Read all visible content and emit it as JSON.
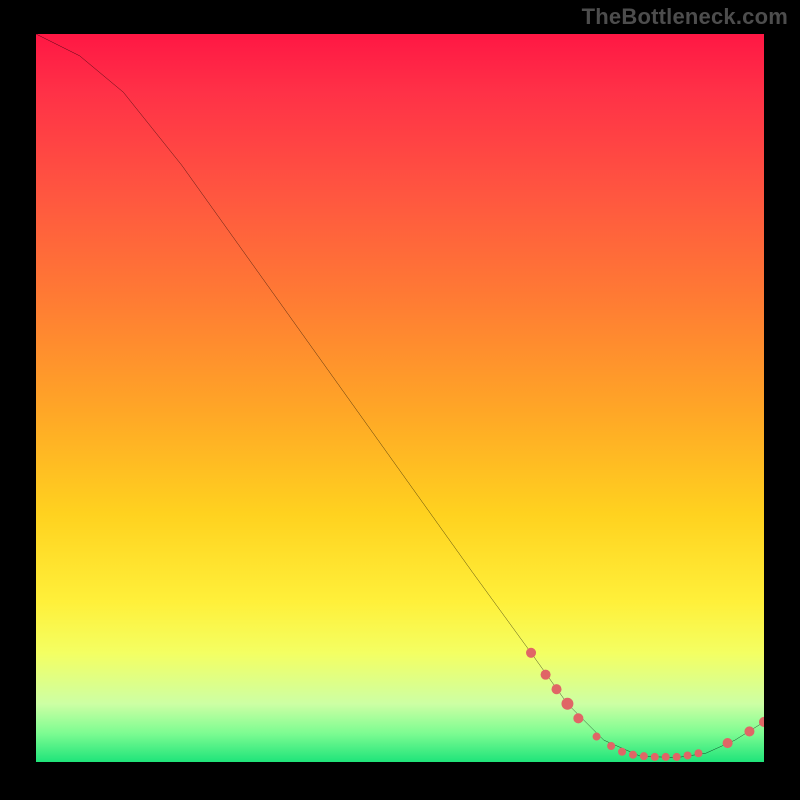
{
  "watermark": "TheBottleneck.com",
  "chart_data": {
    "type": "line",
    "title": "",
    "xlabel": "",
    "ylabel": "",
    "xlim": [
      0,
      100
    ],
    "ylim": [
      0,
      100
    ],
    "curve": {
      "name": "bottleneck-curve",
      "points": [
        {
          "x": 0,
          "y": 100
        },
        {
          "x": 6,
          "y": 97
        },
        {
          "x": 12,
          "y": 92
        },
        {
          "x": 20,
          "y": 82
        },
        {
          "x": 30,
          "y": 68
        },
        {
          "x": 40,
          "y": 54
        },
        {
          "x": 50,
          "y": 40
        },
        {
          "x": 60,
          "y": 26
        },
        {
          "x": 68,
          "y": 15
        },
        {
          "x": 73,
          "y": 8
        },
        {
          "x": 78,
          "y": 3
        },
        {
          "x": 83,
          "y": 0.8
        },
        {
          "x": 88,
          "y": 0.6
        },
        {
          "x": 92,
          "y": 1.2
        },
        {
          "x": 96,
          "y": 3.0
        },
        {
          "x": 100,
          "y": 5.5
        }
      ]
    },
    "markers": {
      "name": "highlight-dots",
      "color": "#e06666",
      "points": [
        {
          "x": 68,
          "y": 15,
          "r": 5
        },
        {
          "x": 70,
          "y": 12,
          "r": 5
        },
        {
          "x": 71.5,
          "y": 10,
          "r": 5
        },
        {
          "x": 73,
          "y": 8,
          "r": 6
        },
        {
          "x": 74.5,
          "y": 6,
          "r": 5
        },
        {
          "x": 77,
          "y": 3.5,
          "r": 4
        },
        {
          "x": 79,
          "y": 2.2,
          "r": 4
        },
        {
          "x": 80.5,
          "y": 1.4,
          "r": 4
        },
        {
          "x": 82,
          "y": 1.0,
          "r": 4
        },
        {
          "x": 83.5,
          "y": 0.8,
          "r": 4
        },
        {
          "x": 85,
          "y": 0.7,
          "r": 4
        },
        {
          "x": 86.5,
          "y": 0.7,
          "r": 4
        },
        {
          "x": 88,
          "y": 0.7,
          "r": 4
        },
        {
          "x": 89.5,
          "y": 0.9,
          "r": 4
        },
        {
          "x": 91,
          "y": 1.2,
          "r": 4
        },
        {
          "x": 95,
          "y": 2.6,
          "r": 5
        },
        {
          "x": 98,
          "y": 4.2,
          "r": 5
        },
        {
          "x": 100,
          "y": 5.5,
          "r": 5
        }
      ]
    }
  }
}
